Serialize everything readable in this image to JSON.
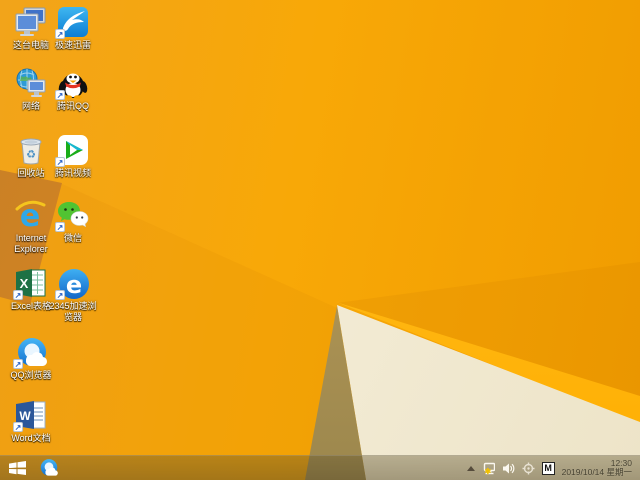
{
  "wallpaper": {
    "base_color": "#F6A50F",
    "stripe_color": "#FFB608",
    "cream_color": "#F6EFDB",
    "tan_color": "#BDA05F",
    "wedge_color": "#DC8A1E"
  },
  "desktop": {
    "icons": [
      {
        "name": "this-pc",
        "label": "这台电脑"
      },
      {
        "name": "thunder-speed",
        "label": "极速迅雷"
      },
      {
        "name": "network",
        "label": "网络"
      },
      {
        "name": "tencent-qq",
        "label": "腾讯QQ"
      },
      {
        "name": "recycle-bin",
        "label": "回收站"
      },
      {
        "name": "tencent-video",
        "label": "腾讯视频"
      },
      {
        "name": "internet-explorer",
        "label": "Internet Explorer"
      },
      {
        "name": "wechat",
        "label": "微信"
      },
      {
        "name": "excel",
        "label": "Excel表格"
      },
      {
        "name": "browser-2345",
        "label": "2345加速浏览器"
      },
      {
        "name": "qq-browser",
        "label": "QQ浏览器"
      },
      {
        "name": "word",
        "label": "Word文档"
      }
    ]
  },
  "taskbar": {
    "start_tooltip": "开始",
    "pinned": [
      {
        "name": "qq-browser-taskbar"
      }
    ],
    "tray": {
      "ime_label": "M",
      "icons": [
        "show-hidden-icons",
        "network-status",
        "volume",
        "safety-target",
        "ime-indicator"
      ]
    },
    "clock": {
      "time": "12:30",
      "date": "2019/10/14 星期一"
    }
  }
}
